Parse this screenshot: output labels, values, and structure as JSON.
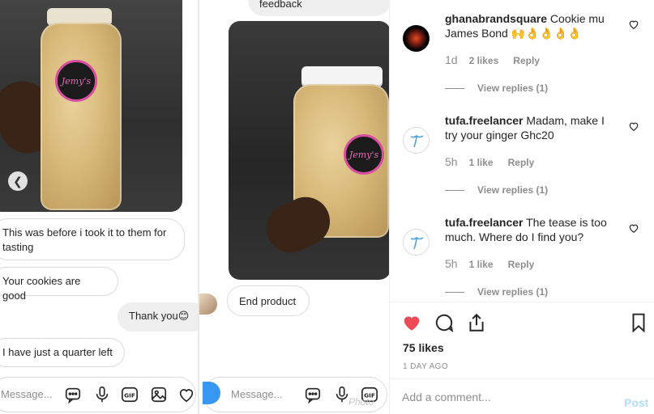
{
  "left_chat": {
    "bubbles": {
      "before_tasting": "This was before i took it to them for tasting",
      "cookies_good": "Your cookies are good",
      "thank_you": "Thank you😊",
      "quarter_left": "I have just a quarter left"
    },
    "label_text": "Jemy's",
    "message_placeholder": "Message..."
  },
  "right_chat": {
    "top_bubble_fragment": "feedback",
    "end_product": "End product",
    "label_text": "Jemy's",
    "message_placeholder": "Message...",
    "watermark": "Photo"
  },
  "comments": [
    {
      "username": "ghanabrandsquare",
      "text": "Cookie mu James Bond 🙌👌👌👌👌",
      "age": "1d",
      "likes": "2 likes",
      "reply_label": "Reply",
      "view_replies": "View replies (1)"
    },
    {
      "username": "tufa.freelancer",
      "text": "Madam, make I try your ginger Ghc20",
      "age": "5h",
      "likes": "1 like",
      "reply_label": "Reply",
      "view_replies": "View replies (1)"
    },
    {
      "username": "tufa.freelancer",
      "text": "The tease is too much. Where do I find you?",
      "age": "5h",
      "likes": "1 like",
      "reply_label": "Reply",
      "view_replies": "View replies (1)"
    }
  ],
  "post": {
    "likes": "75 likes",
    "date": "1 DAY AGO",
    "add_comment_placeholder": "Add a comment...",
    "post_label": "Post"
  },
  "icons": [
    "chevron-left-icon",
    "message-icon",
    "microphone-icon",
    "gif-icon",
    "image-icon",
    "heart-icon",
    "camera-icon",
    "comment-icon",
    "share-icon",
    "bookmark-icon"
  ],
  "colors": {
    "like_red": "#ed4956",
    "link_blue": "#3897f0",
    "post_disabled": "#b2dffc",
    "meta_gray": "#8e8e8e",
    "label_pink": "#d64fa0"
  }
}
